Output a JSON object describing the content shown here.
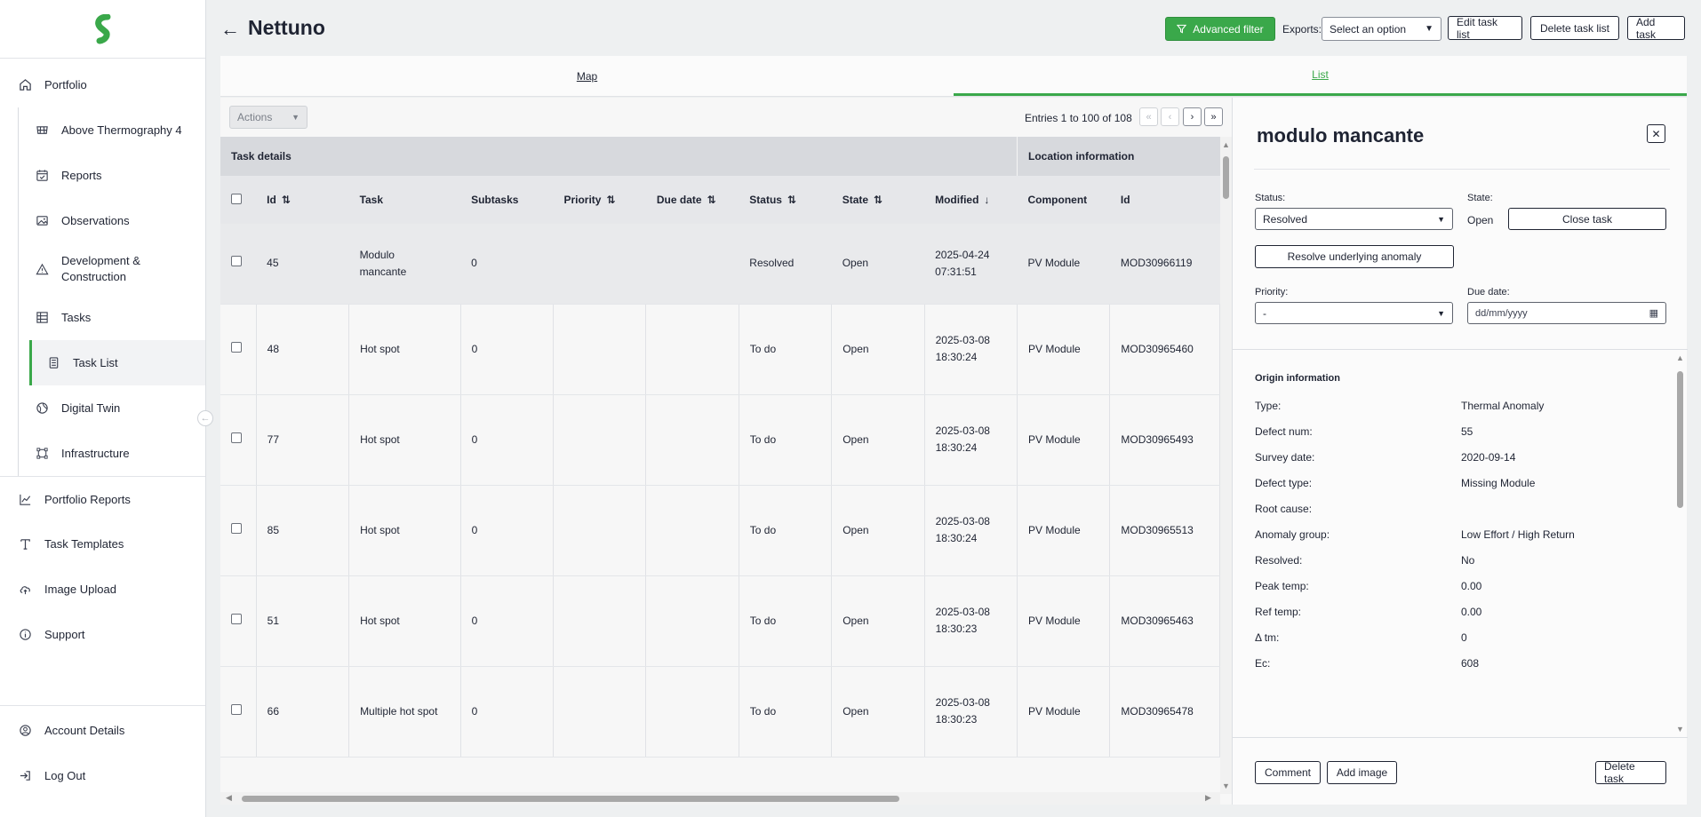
{
  "sidebar": {
    "items": [
      {
        "label": "Portfolio",
        "icon": "home-icon"
      },
      {
        "label": "Above Thermography 4",
        "icon": "solar-panel-icon"
      },
      {
        "label": "Reports",
        "icon": "calendar-check-icon"
      },
      {
        "label": "Observations",
        "icon": "image-icon"
      },
      {
        "label": "Development & Construction",
        "icon": "warning-triangle-icon"
      },
      {
        "label": "Tasks",
        "icon": "table-icon"
      },
      {
        "label": "Task List",
        "icon": "list-icon"
      },
      {
        "label": "Digital Twin",
        "icon": "globe-icon"
      },
      {
        "label": "Infrastructure",
        "icon": "vector-square-icon"
      },
      {
        "label": "Portfolio Reports",
        "icon": "chart-line-icon"
      },
      {
        "label": "Task Templates",
        "icon": "text-icon"
      },
      {
        "label": "Image Upload",
        "icon": "cloud-upload-icon"
      },
      {
        "label": "Support",
        "icon": "info-circle-icon"
      }
    ],
    "bottom": [
      {
        "label": "Account Details",
        "icon": "user-circle-icon"
      },
      {
        "label": "Log Out",
        "icon": "logout-icon"
      }
    ]
  },
  "header": {
    "title": "Nettuno",
    "advanced_filter": "Advanced filter",
    "exports_label": "Exports:",
    "exports_value": "Select an option",
    "edit_task_list": "Edit task list",
    "delete_task_list": "Delete task list",
    "add_task": "Add task"
  },
  "tabs": [
    {
      "label": "Map",
      "active": false
    },
    {
      "label": "List",
      "active": true
    }
  ],
  "table": {
    "actions": "Actions",
    "entries": "Entries 1 to 100 of 108",
    "pager": [
      "«",
      "‹",
      "›",
      "»"
    ],
    "group_headers": [
      "Task details",
      "Location information"
    ],
    "columns": [
      "Id",
      "Task",
      "Subtasks",
      "Priority",
      "Due date",
      "Status",
      "State",
      "Modified",
      "Component",
      "Id"
    ],
    "rows": [
      {
        "id": "45",
        "task": "Modulo mancante",
        "subtasks": "0",
        "priority": "",
        "due": "",
        "status": "Resolved",
        "state": "Open",
        "modified": "2025-04-24 07:31:51",
        "component": "PV Module",
        "loc_id": "MOD30966119"
      },
      {
        "id": "48",
        "task": "Hot spot",
        "subtasks": "0",
        "priority": "",
        "due": "",
        "status": "To do",
        "state": "Open",
        "modified": "2025-03-08 18:30:24",
        "component": "PV Module",
        "loc_id": "MOD30965460"
      },
      {
        "id": "77",
        "task": "Hot spot",
        "subtasks": "0",
        "priority": "",
        "due": "",
        "status": "To do",
        "state": "Open",
        "modified": "2025-03-08 18:30:24",
        "component": "PV Module",
        "loc_id": "MOD30965493"
      },
      {
        "id": "85",
        "task": "Hot spot",
        "subtasks": "0",
        "priority": "",
        "due": "",
        "status": "To do",
        "state": "Open",
        "modified": "2025-03-08 18:30:24",
        "component": "PV Module",
        "loc_id": "MOD30965513"
      },
      {
        "id": "51",
        "task": "Hot spot",
        "subtasks": "0",
        "priority": "",
        "due": "",
        "status": "To do",
        "state": "Open",
        "modified": "2025-03-08 18:30:23",
        "component": "PV Module",
        "loc_id": "MOD30965463"
      },
      {
        "id": "66",
        "task": "Multiple hot spot",
        "subtasks": "0",
        "priority": "",
        "due": "",
        "status": "To do",
        "state": "Open",
        "modified": "2025-03-08 18:30:23",
        "component": "PV Module",
        "loc_id": "MOD30965478"
      }
    ]
  },
  "detail": {
    "title": "modulo mancante",
    "status_label": "Status:",
    "status_value": "Resolved",
    "state_label": "State:",
    "state_value": "Open",
    "close_task": "Close task",
    "resolve_anomaly": "Resolve underlying anomaly",
    "priority_label": "Priority:",
    "priority_value": "-",
    "due_label": "Due date:",
    "due_placeholder": "dd/mm/yyyy",
    "origin_title": "Origin information",
    "origin": [
      {
        "k": "Type:",
        "v": "Thermal Anomaly"
      },
      {
        "k": "Defect num:",
        "v": "55"
      },
      {
        "k": "Survey date:",
        "v": "2020-09-14"
      },
      {
        "k": "Defect type:",
        "v": "Missing Module"
      },
      {
        "k": "Root cause:",
        "v": ""
      },
      {
        "k": "Anomaly group:",
        "v": "Low Effort / High Return"
      },
      {
        "k": "Resolved:",
        "v": "No"
      },
      {
        "k": "Peak temp:",
        "v": "0.00"
      },
      {
        "k": "Ref temp:",
        "v": "0.00"
      },
      {
        "k": "Δ tm:",
        "v": "0"
      },
      {
        "k": "Ec:",
        "v": "608"
      }
    ],
    "comment": "Comment",
    "add_image": "Add image",
    "delete_task": "Delete task"
  },
  "colors": {
    "accent": "#3aa84a",
    "text": "#1f2433"
  }
}
